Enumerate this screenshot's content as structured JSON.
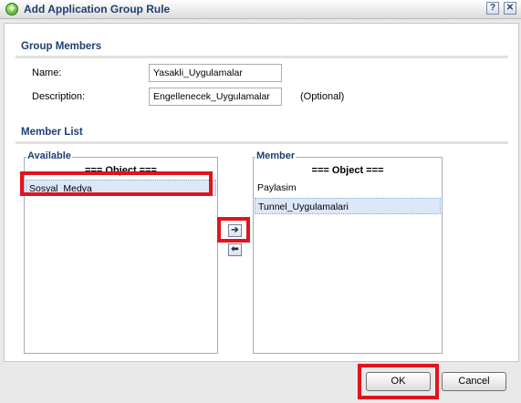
{
  "window": {
    "title": "Add Application Group Rule",
    "help_icon": "help-icon",
    "close_icon": "close-icon"
  },
  "group_members": {
    "section_title": "Group Members",
    "name_label": "Name:",
    "name_value": "Yasakli_Uygulamalar",
    "description_label": "Description:",
    "description_value": "Engellenecek_Uygulamalar",
    "optional_hint": "(Optional)"
  },
  "member_list": {
    "section_title": "Member List",
    "available": {
      "legend": "Available",
      "header": "=== Object ===",
      "items": [
        {
          "label": "Sosyal_Medya"
        }
      ]
    },
    "member": {
      "legend": "Member",
      "header": "=== Object ===",
      "items": [
        {
          "label": "Paylasim"
        },
        {
          "label": "Tunnel_Uygulamalari"
        }
      ]
    },
    "add_icon": "arrow-right-icon",
    "remove_icon": "arrow-left-icon"
  },
  "footer": {
    "ok_label": "OK",
    "cancel_label": "Cancel"
  },
  "colors": {
    "highlight": "#e0141f",
    "section_title": "#1f3f72",
    "selection": "#dce8f8"
  }
}
